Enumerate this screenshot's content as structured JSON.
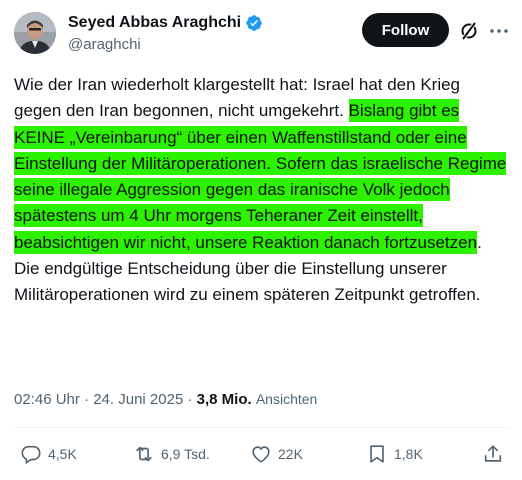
{
  "author": {
    "display_name": "Seyed Abbas Araghchi",
    "handle": "@araghchi",
    "verified": true,
    "avatar_icon": "avatar-photo"
  },
  "header": {
    "follow_label": "Follow",
    "grok_icon": "grok-slash-icon",
    "more_icon": "more-dots-icon"
  },
  "post": {
    "text_before": "Wie der Iran wiederholt klargestellt hat: Israel hat den Krieg gegen den Iran begonnen, nicht umgekehrt. ",
    "text_highlighted": "Bislang gibt es KEINE „Vereinbarung“ über einen Waffenstillstand oder eine Einstellung der Militäroperationen. Sofern das israelische Regime seine illegale Aggression gegen das iranische Volk jedoch spätestens um 4 Uhr morgens Teheraner Zeit einstellt, beabsichtigen wir nicht, unsere Reaktion danach fortzusetzen",
    "text_after": ". Die endgültige Entscheidung über die Einstellung unserer Militäroperationen wird zu einem späteren Zeitpunkt getroffen.",
    "highlight_color": "#2cf200"
  },
  "meta": {
    "time": "02:46 Uhr",
    "separator": "·",
    "date": "24. Juni 2025",
    "views_count": "3,8 Mio.",
    "views_label": "Ansichten"
  },
  "actions": {
    "replies": "4,5K",
    "reposts": "6,9 Tsd.",
    "likes": "22K",
    "bookmarks": "1,8K"
  },
  "colors": {
    "text": "#0f1419",
    "secondary": "#536471",
    "verified": "#1d9bf0",
    "button_bg": "#0f1419"
  }
}
